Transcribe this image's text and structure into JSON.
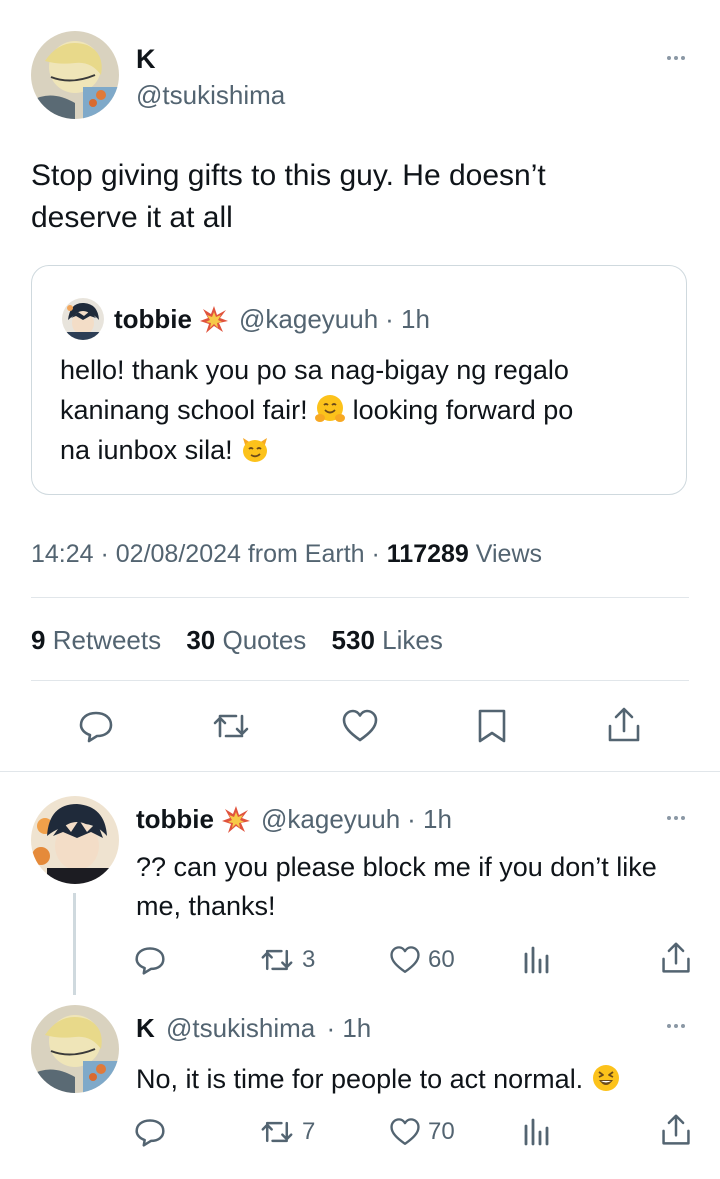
{
  "main_tweet": {
    "display_name": "K",
    "handle": "@tsukishima",
    "text_line1": "Stop giving gifts to this guy. He doesn’t",
    "text_line2": "deserve it at all",
    "quoted": {
      "display_name": "tobbie",
      "handle": "@kageyuuh",
      "time": "· 1h",
      "line1": "hello! thank you po sa nag-bigay ng regalo",
      "line2a": "kaninang school fair! ",
      "line2b": " looking forward po",
      "line3": "na iunbox sila! ",
      "emoji_1": "hugging-face-emoji",
      "emoji_2": "smirking-cat-emoji"
    },
    "timestamp": "14:24 · 02/08/2024 from Earth ·",
    "views_count": "117289",
    "views_label": "Views",
    "stats": {
      "retweets_count": "9",
      "retweets_label": "Retweets",
      "quotes_count": "30",
      "quotes_label": "Quotes",
      "likes_count": "530",
      "likes_label": "Likes"
    },
    "actions": [
      "reply-icon",
      "retweet-icon",
      "like-icon",
      "bookmark-icon",
      "share-icon"
    ]
  },
  "replies": [
    {
      "display_name": "tobbie",
      "handle": "@kageyuuh",
      "time": "· 1h",
      "line1": "?? can you please block me if you don’t like",
      "line2": "me, thanks!",
      "retweets": "3",
      "likes": "60"
    },
    {
      "display_name": "K",
      "handle": "@tsukishima",
      "time": "· 1h",
      "line1": "No, it is time for people to act normal. ",
      "emoji": "grinning-squinting-face-emoji",
      "retweets": "7",
      "likes": "70"
    }
  ],
  "colors": {
    "text": "#0f1419",
    "muted": "#536471",
    "divider": "#e1e6ea",
    "verified_burst": "#e0533d"
  }
}
